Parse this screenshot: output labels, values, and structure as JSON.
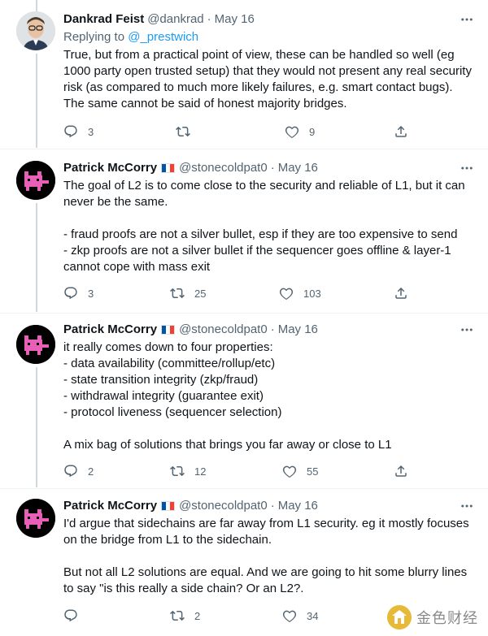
{
  "tweets": [
    {
      "name": "Dankrad Feist",
      "flag": false,
      "handle": "@dankrad",
      "separator": "·",
      "date": "May 16",
      "replying_prefix": "Replying to ",
      "replying_to": "@_prestwich",
      "lines": [
        "True, but from a practical point of view, these can be handled so well (eg 1000 party open trusted setup) that they would not present any real security risk (as compared to much more likely failures, e.g. smart contact bugs).",
        "The same cannot be said of honest majority bridges."
      ],
      "replies": "3",
      "retweets": "",
      "likes": "9"
    },
    {
      "name": "Patrick McCorry",
      "flag": true,
      "handle": "@stonecoldpat0",
      "separator": "·",
      "date": "May 16",
      "paragraphs": [
        "The goal of L2 is to come close to the security and reliable of L1, but it can never be the same.",
        "- fraud proofs are not a silver bullet, esp if they are too expensive to send\n- zkp proofs are not a silver bullet if the sequencer goes offline & layer-1 cannot cope with mass exit"
      ],
      "replies": "3",
      "retweets": "25",
      "likes": "103"
    },
    {
      "name": "Patrick McCorry",
      "flag": true,
      "handle": "@stonecoldpat0",
      "separator": "·",
      "date": "May 16",
      "paragraphs": [
        "it really comes down to four properties:\n- data availability (committee/rollup/etc)\n- state transition integrity (zkp/fraud)\n- withdrawal integrity (guarantee exit)\n- protocol liveness (sequencer selection)",
        "A mix bag of solutions that brings you far away or close to L1"
      ],
      "replies": "2",
      "retweets": "12",
      "likes": "55"
    },
    {
      "name": "Patrick McCorry",
      "flag": true,
      "handle": "@stonecoldpat0",
      "separator": "·",
      "date": "May 16",
      "paragraphs": [
        "I'd argue that sidechains are far away from L1 security. eg it mostly focuses on the bridge from L1 to the sidechain.",
        "But not all L2 solutions are equal. And we are going to hit some blurry lines to say \"is this really a side chain? Or an L2?."
      ],
      "replies": "",
      "retweets": "2",
      "likes": "34"
    }
  ],
  "watermark": {
    "text": "金色财经"
  },
  "colors": {
    "text": "#0f1419",
    "muted": "#536471",
    "link": "#1d9bf0",
    "thread": "#cfd9de",
    "divider": "#eff3f4"
  }
}
